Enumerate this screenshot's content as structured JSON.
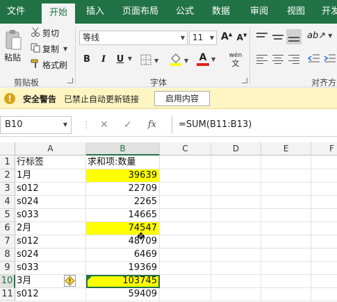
{
  "ribbon_tabs": [
    "文件",
    "开始",
    "插入",
    "页面布局",
    "公式",
    "数据",
    "审阅",
    "视图",
    "开发"
  ],
  "clipboard": {
    "paste": "粘贴",
    "cut": "剪切",
    "copy": "复制",
    "format_painter": "格式刷",
    "group_label": "剪贴板"
  },
  "font": {
    "name": "等线",
    "size": "11",
    "grow": "A",
    "shrink": "A",
    "bold": "B",
    "italic": "I",
    "underline": "U",
    "font_color": "A",
    "phonetic_top": "wén",
    "phonetic_bottom": "文",
    "group_label": "字体"
  },
  "alignment": {
    "group_label": "对齐方"
  },
  "warning": {
    "title": "安全警告",
    "message": "已禁止自动更新链接",
    "button": "启用内容"
  },
  "formula_bar": {
    "name_box": "B10",
    "fx": "fx",
    "formula": "=SUM(B11:B13)"
  },
  "columns": [
    "A",
    "B",
    "C",
    "D",
    "E",
    "F"
  ],
  "active_column": "B",
  "active_row": "10",
  "rows": [
    {
      "num": "1",
      "a": "行标签",
      "b": "求和项:数量",
      "b_is_header": true,
      "highlight": false
    },
    {
      "num": "2",
      "a": "1月",
      "b": "39639",
      "highlight": true
    },
    {
      "num": "3",
      "a": "s012",
      "b": "22709",
      "highlight": false
    },
    {
      "num": "4",
      "a": "s024",
      "b": "2265",
      "highlight": false
    },
    {
      "num": "5",
      "a": "s033",
      "b": "14665",
      "highlight": false
    },
    {
      "num": "6",
      "a": "2月",
      "b": "74547",
      "highlight": true
    },
    {
      "num": "7",
      "a": "s012",
      "b": "48709",
      "highlight": false
    },
    {
      "num": "8",
      "a": "s024",
      "b": "6469",
      "highlight": false
    },
    {
      "num": "9",
      "a": "s033",
      "b": "19369",
      "highlight": false
    },
    {
      "num": "10",
      "a": "3月",
      "b": "103745",
      "highlight": true,
      "active": true
    },
    {
      "num": "11",
      "a": "s012",
      "b": "59409",
      "highlight": false
    }
  ],
  "colors": {
    "excel_green": "#217346",
    "highlight_yellow": "#ffff00",
    "warning_bar": "#fff5c2"
  }
}
